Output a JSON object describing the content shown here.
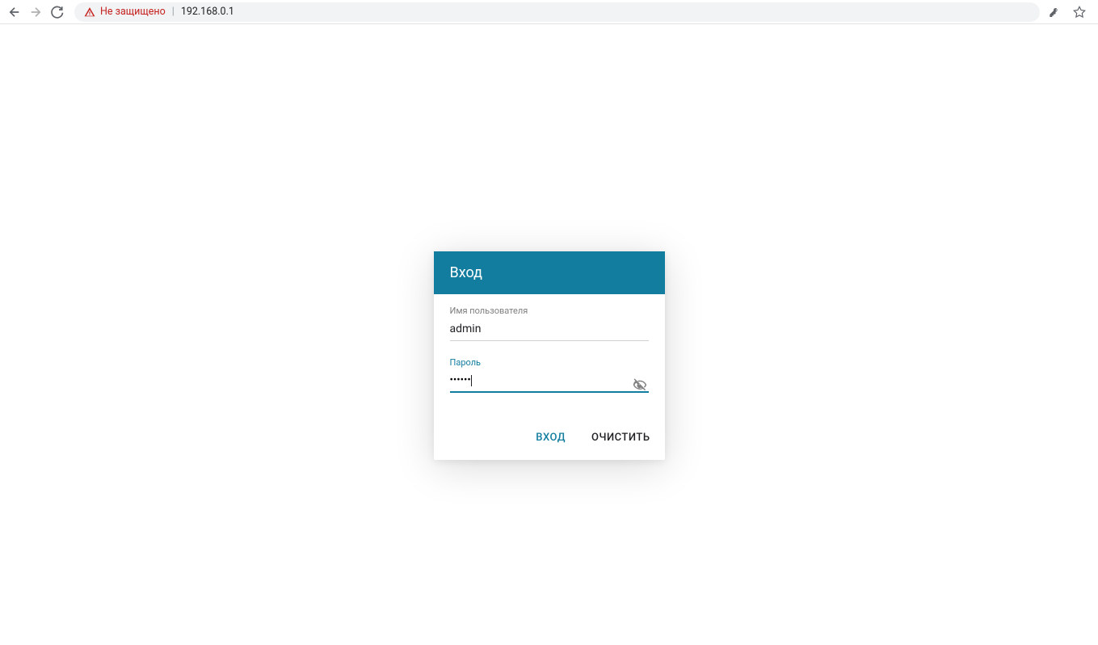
{
  "browser": {
    "not_secure_text": "Не защищено",
    "url": "192.168.0.1"
  },
  "login": {
    "title": "Вход",
    "username_label": "Имя пользователя",
    "username_value": "admin",
    "password_label": "Пароль",
    "password_value": "••••••",
    "login_button": "ВХОД",
    "clear_button": "ОЧИСТИТЬ"
  },
  "colors": {
    "accent": "#127d9e",
    "warning": "#c5221f"
  }
}
